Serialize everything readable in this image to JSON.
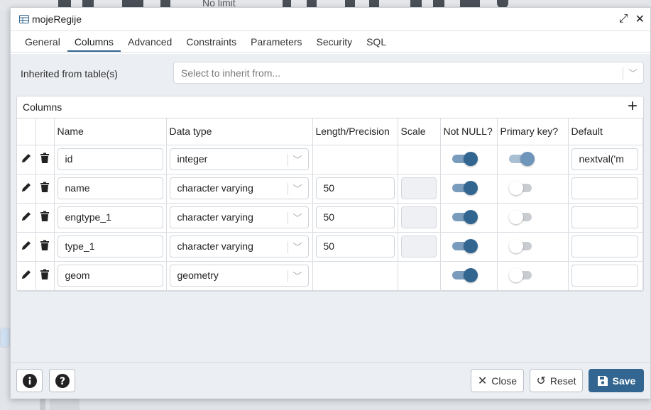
{
  "background_toolbar": {
    "limit_label": "No limit"
  },
  "dialog": {
    "title": "mojeRegije",
    "tabs": [
      "General",
      "Columns",
      "Advanced",
      "Constraints",
      "Parameters",
      "Security",
      "SQL"
    ],
    "active_tab": "Columns"
  },
  "inherit": {
    "label": "Inherited from table(s)",
    "placeholder": "Select to inherit from..."
  },
  "columns_panel": {
    "title": "Columns",
    "headers": [
      "Name",
      "Data type",
      "Length/Precision",
      "Scale",
      "Not NULL?",
      "Primary key?",
      "Default"
    ],
    "rows": [
      {
        "name": "id",
        "data_type": "integer",
        "length": "",
        "has_length": false,
        "not_null": true,
        "primary_key": true,
        "default": "nextval('m",
        "scale_enabled": false
      },
      {
        "name": "name",
        "data_type": "character varying",
        "length": "50",
        "has_length": true,
        "not_null": true,
        "primary_key": false,
        "default": "",
        "scale_enabled": true
      },
      {
        "name": "engtype_1",
        "data_type": "character varying",
        "length": "50",
        "has_length": true,
        "not_null": true,
        "primary_key": false,
        "default": "",
        "scale_enabled": true
      },
      {
        "name": "type_1",
        "data_type": "character varying",
        "length": "50",
        "has_length": true,
        "not_null": true,
        "primary_key": false,
        "default": "",
        "scale_enabled": true
      },
      {
        "name": "geom",
        "data_type": "geometry",
        "length": "",
        "has_length": false,
        "not_null": true,
        "primary_key": false,
        "default": "",
        "scale_enabled": false
      }
    ]
  },
  "footer": {
    "close_label": "Close",
    "reset_label": "Reset",
    "save_label": "Save"
  },
  "colors": {
    "accent": "#326690",
    "toggle_track_on": "#7a9cbc"
  }
}
